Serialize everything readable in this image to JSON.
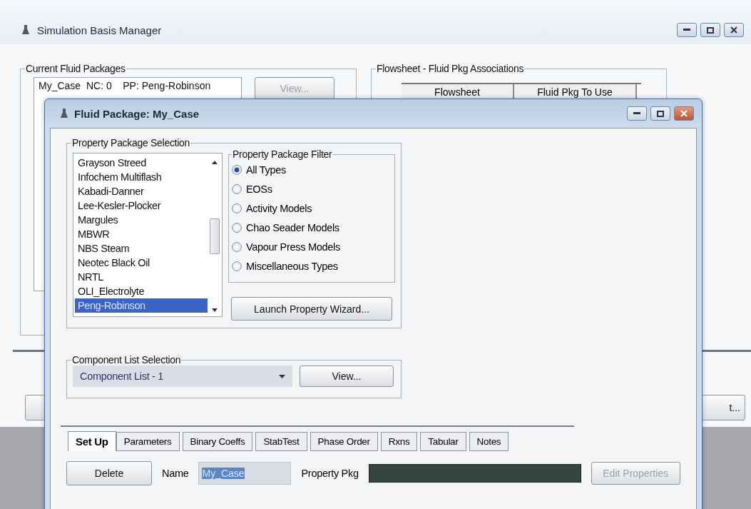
{
  "main_window": {
    "title": "Simulation Basis Manager",
    "current_fluid_packages": {
      "title": "Current Fluid Packages",
      "items": [
        {
          "text": "My_Case  NC: 0    PP: Peng-Robinson",
          "selected": false
        }
      ],
      "view_button": {
        "label": "View...",
        "disabled": true
      }
    },
    "associations": {
      "title": "Flowsheet - Fluid Pkg Associations",
      "columns": [
        "Flowsheet",
        "Fluid Pkg To Use"
      ]
    },
    "bottom_button": {
      "label": "t..."
    }
  },
  "dialog": {
    "title": "Fluid Package: My_Case",
    "property_package_selection": {
      "title": "Property Package Selection",
      "items": [
        {
          "label": "Grayson Streed",
          "selected": false
        },
        {
          "label": "Infochem Multiflash",
          "selected": false
        },
        {
          "label": "Kabadi-Danner",
          "selected": false
        },
        {
          "label": "Lee-Kesler-Plocker",
          "selected": false
        },
        {
          "label": "Margules",
          "selected": false
        },
        {
          "label": "MBWR",
          "selected": false
        },
        {
          "label": "NBS Steam",
          "selected": false
        },
        {
          "label": "Neotec Black Oil",
          "selected": false
        },
        {
          "label": "NRTL",
          "selected": false
        },
        {
          "label": "OLI_Electrolyte",
          "selected": false
        },
        {
          "label": "Peng-Robinson",
          "selected": true
        }
      ],
      "filter": {
        "title": "Property Package Filter",
        "options": [
          {
            "label": "All Types",
            "selected": true
          },
          {
            "label": "EOSs",
            "selected": false
          },
          {
            "label": "Activity Models",
            "selected": false
          },
          {
            "label": "Chao Seader Models",
            "selected": false
          },
          {
            "label": "Vapour Press Models",
            "selected": false
          },
          {
            "label": "Miscellaneous Types",
            "selected": false
          }
        ]
      },
      "launch_button": {
        "label": "Launch Property Wizard..."
      }
    },
    "component_list_selection": {
      "title": "Component List Selection",
      "value": "Component List - 1",
      "view_button": {
        "label": "View..."
      }
    },
    "tabs": [
      {
        "label": "Set Up",
        "selected": true
      },
      {
        "label": "Parameters",
        "selected": false
      },
      {
        "label": "Binary Coeffs",
        "selected": false
      },
      {
        "label": "StabTest",
        "selected": false
      },
      {
        "label": "Phase Order",
        "selected": false
      },
      {
        "label": "Rxns",
        "selected": false
      },
      {
        "label": "Tabular",
        "selected": false
      },
      {
        "label": "Notes",
        "selected": false
      }
    ],
    "footer": {
      "delete_button": {
        "label": "Delete"
      },
      "name_label": "Name",
      "name_value": "My_Case",
      "name_highlighted": true,
      "property_pkg_label": "Property Pkg",
      "edit_properties_button": {
        "label": "Edit Properties",
        "disabled": true
      }
    }
  }
}
